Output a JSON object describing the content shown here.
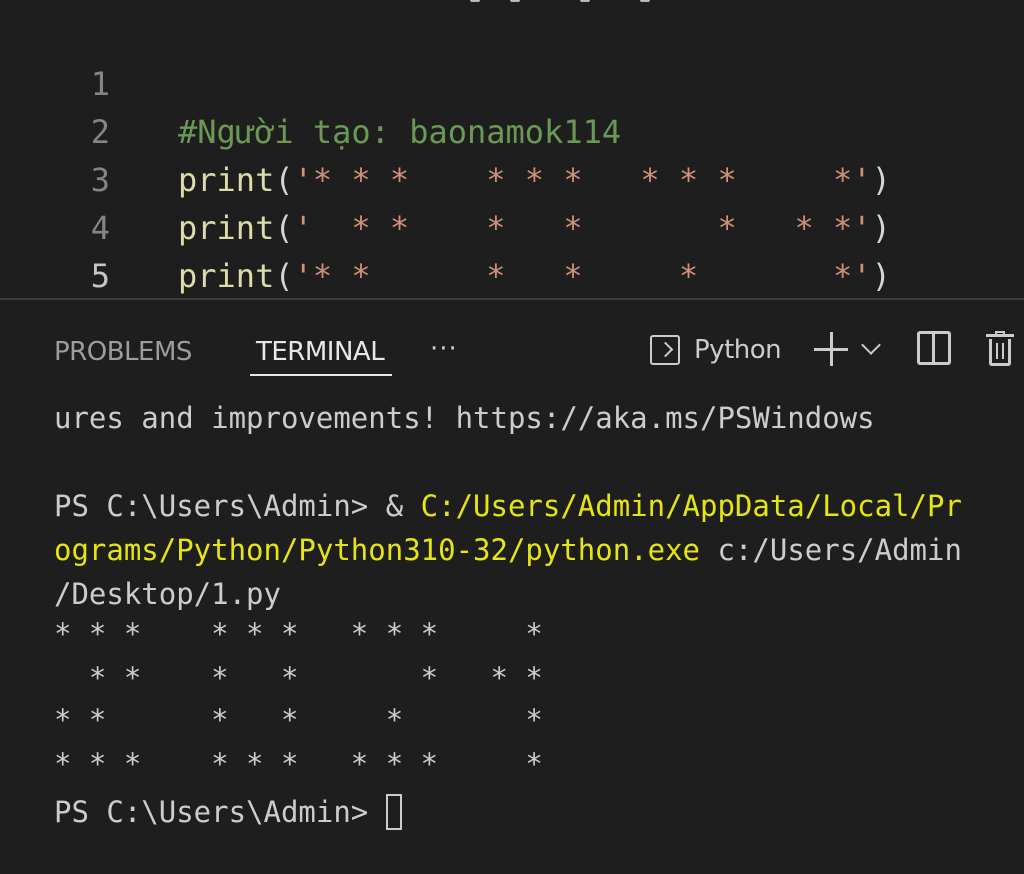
{
  "editor": {
    "lines": [
      {
        "number": "1",
        "comment": "#Người tạo: baonamok114"
      },
      {
        "number": "2",
        "fn": "print",
        "open": "(",
        "str": "'* * *    * * *   * * *     *'",
        "close": ")"
      },
      {
        "number": "3",
        "fn": "print",
        "open": "(",
        "str": "'  * *    *   *       *   * *'",
        "close": ")"
      },
      {
        "number": "4",
        "fn": "print",
        "open": "(",
        "str": "'* *      *   *     *       *'",
        "close": ")"
      },
      {
        "number": "5",
        "fn": "print",
        "open": "(",
        "str": "'* * *    * * *   * * *     *'",
        "close": ")"
      }
    ]
  },
  "panel": {
    "tabs": {
      "problems": "PROBLEMS",
      "terminal": "TERMINAL",
      "more": "···"
    },
    "terminal_kind": "Python"
  },
  "terminal": {
    "line1": "ures and improvements! https://aka.ms/PSWindows",
    "prompt1": "PS C:\\Users\\Admin> & ",
    "exe_part1": "C:/Users/Admin/AppData/Local/Pr",
    "exe_part2": "ograms/Python/Python310-32/python.exe",
    "arg_part1": " c:/Users/Admin",
    "arg_part2": "/Desktop/1.py",
    "output": [
      "* * *    * * *   * * *     *",
      "  * *    *   *       *   * *",
      "* *      *   *     *       *",
      "* * *    * * *   * * *     *"
    ],
    "prompt2": "PS C:\\Users\\Admin> "
  },
  "colors": {
    "background": "#1e1e1e",
    "comment": "#6a9955",
    "function": "#dcdcaa",
    "string": "#ce9178",
    "path_highlight": "#e5e510",
    "text": "#cccccc"
  }
}
